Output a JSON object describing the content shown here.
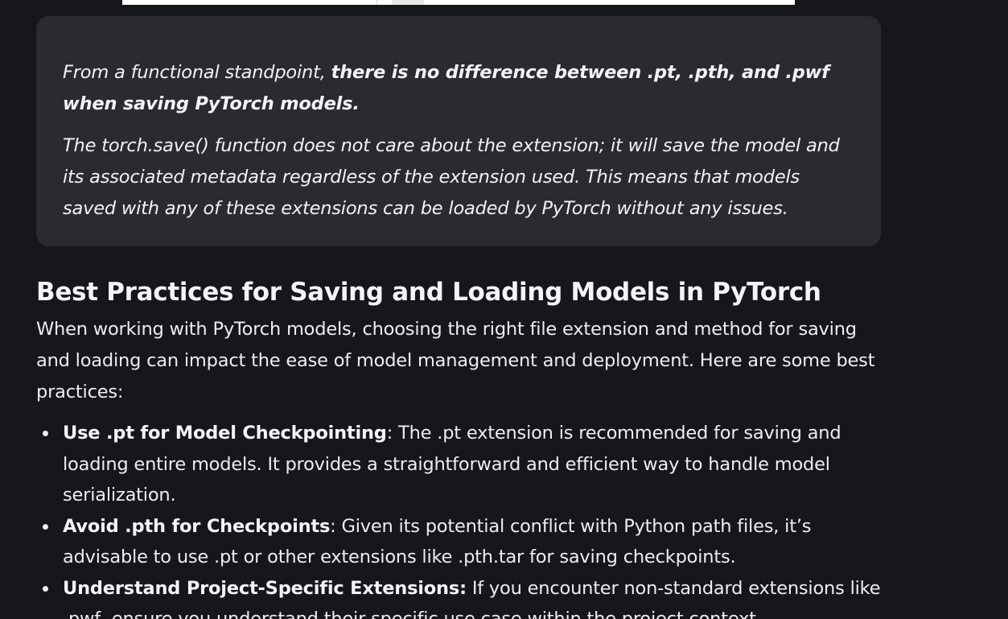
{
  "callout": {
    "lead_text": "From a functional standpoint, ",
    "emphasis_text": "there is no difference between .pt, .pth, and .pwf when saving PyTorch models.",
    "paragraph": "The torch.save() function does not care about the extension; it will save the model and its associated metadata regardless of the extension used. This means that models saved with any of these extensions can be loaded by PyTorch without any issues."
  },
  "section": {
    "heading": "Best Practices for Saving and Loading Models in PyTorch",
    "intro": "When working with PyTorch models, choosing the right file extension and method for saving and loading can impact the ease of model management and deployment. Here are some best practices:",
    "items": [
      {
        "title": "Use .pt for Model Checkpointing",
        "text": ": The .pt extension is recommended for saving and loading entire models. It provides a straightforward and efficient way to handle model serialization."
      },
      {
        "title": "Avoid .pth for Checkpoints",
        "text": ": Given its potential conflict with Python path files, it’s advisable to use .pt or other extensions like .pth.tar for saving checkpoints."
      },
      {
        "title": "Understand Project-Specific Extensions:",
        "text": " If you encounter non-standard extensions like .pwf, ensure you understand their specific use case within the project context."
      }
    ]
  }
}
